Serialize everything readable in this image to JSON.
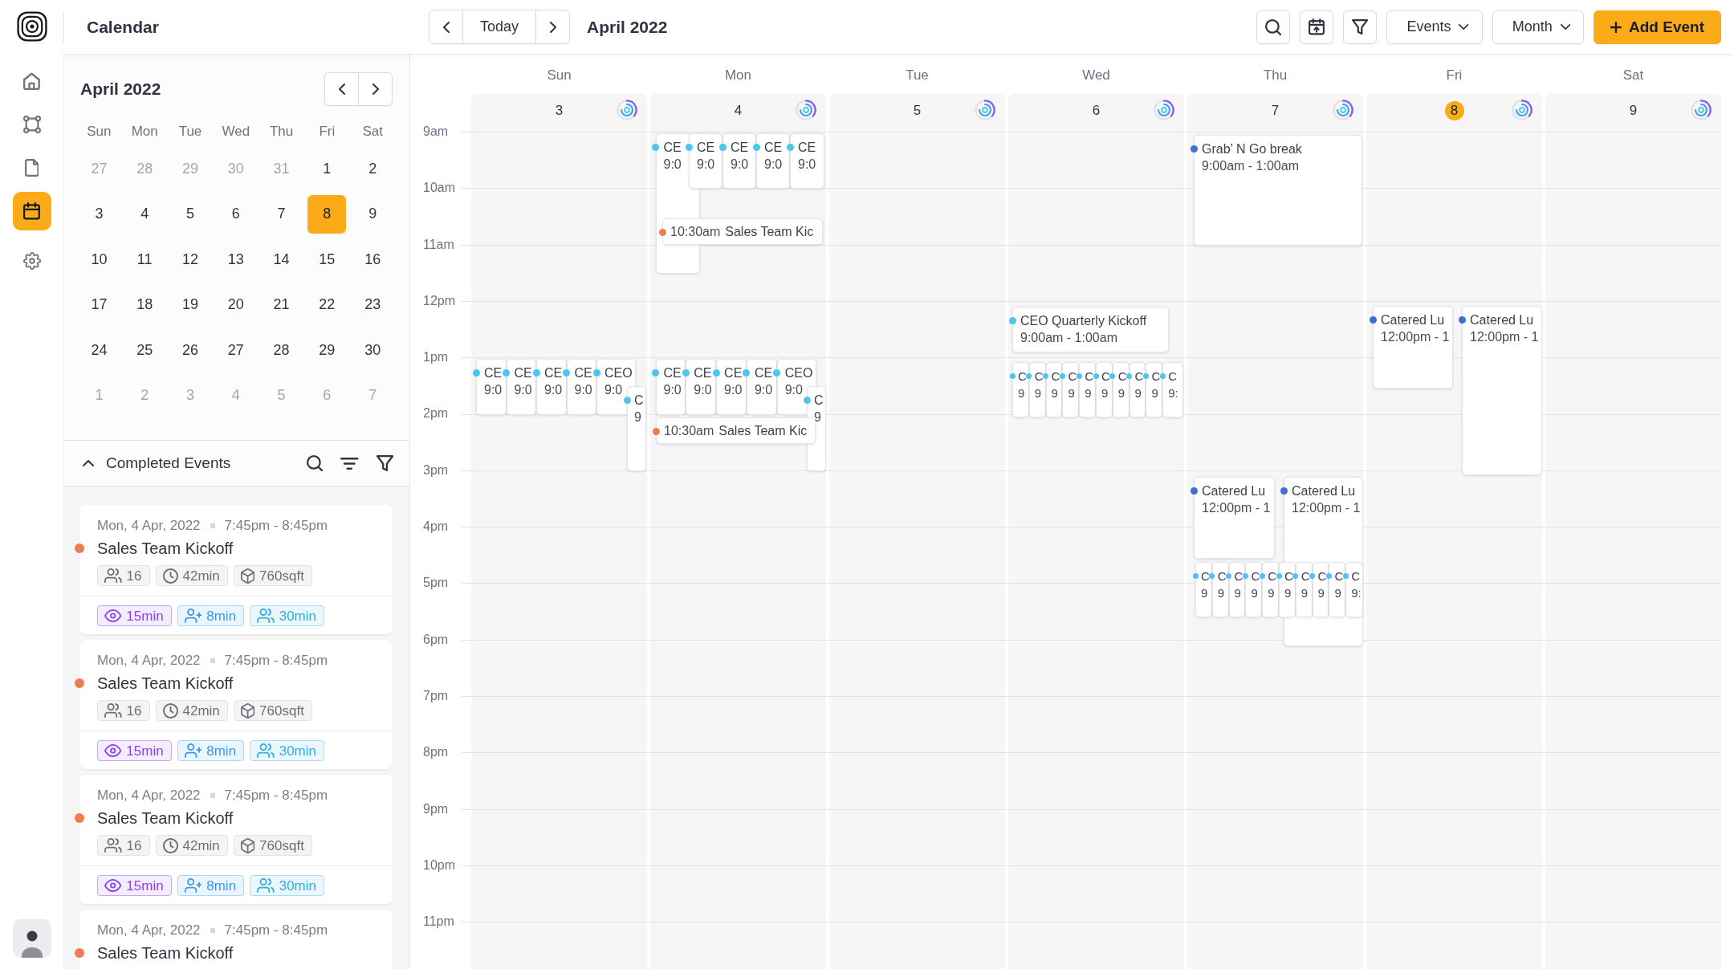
{
  "app": {
    "title": "Calendar"
  },
  "nav": [
    {
      "kind": "home",
      "selected": false
    },
    {
      "kind": "nodes",
      "selected": false
    },
    {
      "kind": "document",
      "selected": false
    },
    {
      "kind": "calendar",
      "selected": true
    },
    {
      "kind": "settings",
      "selected": false
    }
  ],
  "toolbar": {
    "today": "Today",
    "period": "April 2022",
    "dropdowns": [
      "Events",
      "Month"
    ],
    "add_button": "Add Event"
  },
  "mini_calendar": {
    "title": "April 2022",
    "weekdays": [
      "Sun",
      "Mon",
      "Tue",
      "Wed",
      "Thu",
      "Fri",
      "Sat"
    ],
    "days": [
      {
        "label": "27",
        "outside_month": true,
        "selected": false
      },
      {
        "label": "28",
        "outside_month": true,
        "selected": false
      },
      {
        "label": "29",
        "outside_month": true,
        "selected": false
      },
      {
        "label": "30",
        "outside_month": true,
        "selected": false
      },
      {
        "label": "31",
        "outside_month": true,
        "selected": false
      },
      {
        "label": "1",
        "outside_month": false,
        "selected": false
      },
      {
        "label": "2",
        "outside_month": false,
        "selected": false
      },
      {
        "label": "3",
        "outside_month": false,
        "selected": false
      },
      {
        "label": "4",
        "outside_month": false,
        "selected": false
      },
      {
        "label": "5",
        "outside_month": false,
        "selected": false
      },
      {
        "label": "6",
        "outside_month": false,
        "selected": false
      },
      {
        "label": "7",
        "outside_month": false,
        "selected": false
      },
      {
        "label": "8",
        "outside_month": false,
        "selected": true
      },
      {
        "label": "9",
        "outside_month": false,
        "selected": false
      },
      {
        "label": "10",
        "outside_month": false,
        "selected": false
      },
      {
        "label": "11",
        "outside_month": false,
        "selected": false
      },
      {
        "label": "12",
        "outside_month": false,
        "selected": false
      },
      {
        "label": "13",
        "outside_month": false,
        "selected": false
      },
      {
        "label": "14",
        "outside_month": false,
        "selected": false
      },
      {
        "label": "15",
        "outside_month": false,
        "selected": false
      },
      {
        "label": "16",
        "outside_month": false,
        "selected": false
      },
      {
        "label": "17",
        "outside_month": false,
        "selected": false
      },
      {
        "label": "18",
        "outside_month": false,
        "selected": false
      },
      {
        "label": "19",
        "outside_month": false,
        "selected": false
      },
      {
        "label": "20",
        "outside_month": false,
        "selected": false
      },
      {
        "label": "21",
        "outside_month": false,
        "selected": false
      },
      {
        "label": "22",
        "outside_month": false,
        "selected": false
      },
      {
        "label": "23",
        "outside_month": false,
        "selected": false
      },
      {
        "label": "24",
        "outside_month": false,
        "selected": false
      },
      {
        "label": "25",
        "outside_month": false,
        "selected": false
      },
      {
        "label": "26",
        "outside_month": false,
        "selected": false
      },
      {
        "label": "27",
        "outside_month": false,
        "selected": false
      },
      {
        "label": "28",
        "outside_month": false,
        "selected": false
      },
      {
        "label": "29",
        "outside_month": false,
        "selected": false
      },
      {
        "label": "30",
        "outside_month": false,
        "selected": false
      },
      {
        "label": "1",
        "outside_month": true,
        "selected": false
      },
      {
        "label": "2",
        "outside_month": true,
        "selected": false
      },
      {
        "label": "3",
        "outside_month": true,
        "selected": false
      },
      {
        "label": "4",
        "outside_month": true,
        "selected": false
      },
      {
        "label": "5",
        "outside_month": true,
        "selected": false
      },
      {
        "label": "6",
        "outside_month": true,
        "selected": false
      },
      {
        "label": "7",
        "outside_month": true,
        "selected": false
      }
    ]
  },
  "completed_events": {
    "title": "Completed Events",
    "expanded": true,
    "items": [
      {
        "date": "Mon, 4 Apr, 2022",
        "time": "7:45pm - 8:45pm",
        "title": "Sales Team Kickoff",
        "color": "#ef7b50",
        "stats": [
          {
            "kind": "attendees",
            "value": "16"
          },
          {
            "kind": "duration",
            "value": "42min"
          },
          {
            "kind": "area",
            "value": "760sqft"
          }
        ],
        "timers": [
          {
            "kind": "views",
            "value": "15min"
          },
          {
            "kind": "added",
            "value": "8min"
          },
          {
            "kind": "group",
            "value": "30min"
          }
        ]
      },
      {
        "date": "Mon, 4 Apr, 2022",
        "time": "7:45pm - 8:45pm",
        "title": "Sales Team Kickoff",
        "color": "#ef7b50",
        "stats": [
          {
            "kind": "attendees",
            "value": "16"
          },
          {
            "kind": "duration",
            "value": "42min"
          },
          {
            "kind": "area",
            "value": "760sqft"
          }
        ],
        "timers": [
          {
            "kind": "views",
            "value": "15min"
          },
          {
            "kind": "added",
            "value": "8min"
          },
          {
            "kind": "group",
            "value": "30min"
          }
        ]
      },
      {
        "date": "Mon, 4 Apr, 2022",
        "time": "7:45pm - 8:45pm",
        "title": "Sales Team Kickoff",
        "color": "#ef7b50",
        "stats": [
          {
            "kind": "attendees",
            "value": "16"
          },
          {
            "kind": "duration",
            "value": "42min"
          },
          {
            "kind": "area",
            "value": "760sqft"
          }
        ],
        "timers": [
          {
            "kind": "views",
            "value": "15min"
          },
          {
            "kind": "added",
            "value": "8min"
          },
          {
            "kind": "group",
            "value": "30min"
          }
        ]
      },
      {
        "date": "Mon, 4 Apr, 2022",
        "time": "7:45pm - 8:45pm",
        "title": "Sales Team Kickoff",
        "color": "#ef7b50"
      }
    ]
  },
  "week": {
    "hours": [
      "9am",
      "10am",
      "11am",
      "12pm",
      "1pm",
      "2pm",
      "3pm",
      "4pm",
      "5pm",
      "6pm",
      "7pm",
      "8pm",
      "9pm",
      "10pm",
      "11pm"
    ],
    "days": [
      {
        "name": "Sun",
        "date": "3",
        "selected": false,
        "events": [
          {
            "kind": "block",
            "title": "CE",
            "time": "9:0",
            "color": "#4cc6ef"
          },
          {
            "kind": "block",
            "title": "CE",
            "time": "9:0",
            "color": "#4cc6ef"
          },
          {
            "kind": "block",
            "title": "CE",
            "time": "9:0",
            "color": "#4cc6ef"
          },
          {
            "kind": "block",
            "title": "CE",
            "time": "9:0",
            "color": "#4cc6ef"
          },
          {
            "kind": "block",
            "title": "CEO",
            "time": "9:0",
            "color": "#4cc6ef"
          },
          {
            "kind": "block",
            "title": "C",
            "time": "9",
            "color": "#4cc6ef"
          }
        ]
      },
      {
        "name": "Mon",
        "date": "4",
        "selected": false,
        "events": [
          {
            "kind": "block",
            "title": "CE",
            "time": "9:0",
            "color": "#4cc6ef"
          },
          {
            "kind": "block",
            "title": "CE",
            "time": "9:0",
            "color": "#4cc6ef"
          },
          {
            "kind": "block",
            "title": "CE",
            "time": "9:0",
            "color": "#4cc6ef"
          },
          {
            "kind": "block",
            "title": "CE",
            "time": "9:0",
            "color": "#4cc6ef"
          },
          {
            "kind": "block",
            "title": "CE",
            "time": "9:0",
            "color": "#4cc6ef"
          },
          {
            "kind": "inline",
            "time": "10:30am",
            "title": "Sales Team Kic",
            "color": "#ef7b50"
          },
          {
            "kind": "block",
            "title": "CE",
            "time": "9:0",
            "color": "#4cc6ef"
          },
          {
            "kind": "block",
            "title": "CE",
            "time": "9:0",
            "color": "#4cc6ef"
          },
          {
            "kind": "block",
            "title": "CE",
            "time": "9:0",
            "color": "#4cc6ef"
          },
          {
            "kind": "block",
            "title": "CE",
            "time": "9:0",
            "color": "#4cc6ef"
          },
          {
            "kind": "block",
            "title": "CEO",
            "time": "9:0",
            "color": "#4cc6ef"
          },
          {
            "kind": "block",
            "title": "C",
            "time": "9",
            "color": "#4cc6ef"
          },
          {
            "kind": "inline",
            "time": "10:30am",
            "title": "Sales Team Kic",
            "color": "#ef7b50"
          }
        ]
      },
      {
        "name": "Tue",
        "date": "5",
        "selected": false
      },
      {
        "name": "Wed",
        "date": "6",
        "selected": false,
        "events": [
          {
            "kind": "block",
            "title": "CEO Quarterly Kickoff",
            "time": "9:00am - 1:00am",
            "color": "#4cc6ef"
          },
          {
            "kind": "block",
            "title": "C",
            "time": "9",
            "color": "#4cc6ef"
          },
          {
            "kind": "block",
            "title": "C",
            "time": "9",
            "color": "#4cc6ef"
          },
          {
            "kind": "block",
            "title": "C",
            "time": "9",
            "color": "#4cc6ef"
          },
          {
            "kind": "block",
            "title": "C",
            "time": "9",
            "color": "#4cc6ef"
          },
          {
            "kind": "block",
            "title": "C",
            "time": "9",
            "color": "#4cc6ef"
          },
          {
            "kind": "block",
            "title": "C",
            "time": "9",
            "color": "#4cc6ef"
          },
          {
            "kind": "block",
            "title": "C",
            "time": "9",
            "color": "#4cc6ef"
          },
          {
            "kind": "block",
            "title": "C",
            "time": "9",
            "color": "#4cc6ef"
          },
          {
            "kind": "block",
            "title": "C",
            "time": "9",
            "color": "#4cc6ef"
          },
          {
            "kind": "block",
            "title": "C",
            "time": "9:",
            "color": "#4cc6ef"
          }
        ]
      },
      {
        "name": "Thu",
        "date": "7",
        "selected": false,
        "events": [
          {
            "kind": "block",
            "title": "Grab’ N Go break",
            "time": "9:00am - 1:00am",
            "color": "#3e6fd6"
          },
          {
            "kind": "block",
            "title": "Catered Lu",
            "time": "12:00pm - 1",
            "color": "#3e6fd6"
          },
          {
            "kind": "block",
            "title": "Catered Lu",
            "time": "12:00pm - 1",
            "color": "#3e6fd6"
          },
          {
            "kind": "block",
            "title": "C",
            "time": "9",
            "color": "#4cc6ef"
          },
          {
            "kind": "block",
            "title": "C",
            "time": "9",
            "color": "#4cc6ef"
          },
          {
            "kind": "block",
            "title": "C",
            "time": "9",
            "color": "#4cc6ef"
          },
          {
            "kind": "block",
            "title": "C",
            "time": "9",
            "color": "#4cc6ef"
          },
          {
            "kind": "block",
            "title": "C",
            "time": "9",
            "color": "#4cc6ef"
          },
          {
            "kind": "block",
            "title": "C",
            "time": "9",
            "color": "#4cc6ef"
          },
          {
            "kind": "block",
            "title": "C",
            "time": "9",
            "color": "#4cc6ef"
          },
          {
            "kind": "block",
            "title": "C",
            "time": "9",
            "color": "#4cc6ef"
          },
          {
            "kind": "block",
            "title": "C",
            "time": "9",
            "color": "#4cc6ef"
          },
          {
            "kind": "block",
            "title": "C",
            "time": "9:",
            "color": "#4cc6ef"
          }
        ]
      },
      {
        "name": "Fri",
        "date": "8",
        "selected": true,
        "events": [
          {
            "kind": "block",
            "title": "Catered Lu",
            "time": "12:00pm - 1",
            "color": "#3e6fd6"
          },
          {
            "kind": "block",
            "title": "Catered Lu",
            "time": "12:00pm - 1",
            "color": "#3e6fd6"
          }
        ]
      },
      {
        "name": "Sat",
        "date": "9",
        "selected": false
      }
    ]
  }
}
